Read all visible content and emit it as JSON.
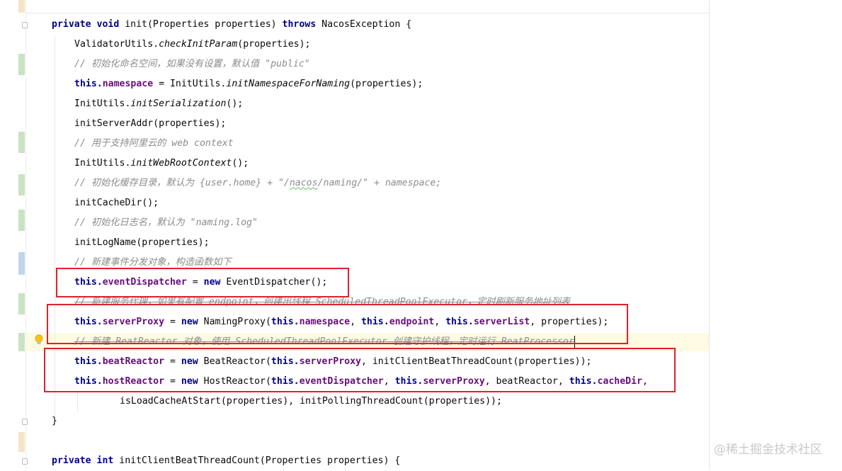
{
  "editor": {
    "lines": {
      "l1": {
        "kw1": "private",
        "kw2": "void",
        "name": " init(Properties properties) ",
        "kw3": "throws",
        "rest": " NacosException {"
      },
      "l2": {
        "a": "ValidatorUtils.",
        "b": "checkInitParam",
        "c": "(properties);"
      },
      "l3": {
        "text": "// 初始化命名空间，如果没有设置，默认值 \"public\""
      },
      "l4": {
        "kw": "this.",
        "fld": "namespace",
        "a": " = InitUtils.",
        "b": "initNamespaceForNaming",
        "c": "(properties);"
      },
      "l5": {
        "a": "InitUtils.",
        "b": "initSerialization",
        "c": "();"
      },
      "l6": {
        "text": "initServerAddr(properties);"
      },
      "l7": {
        "text": "// 用于支持阿里云的 web context"
      },
      "l8": {
        "a": "InitUtils.",
        "b": "initWebRootContext",
        "c": "();"
      },
      "l9": {
        "a": "// 初始化缓存目录，默认为 {user.home} + \"/",
        "b": "nacos",
        "c": "/naming/\" + namespace;"
      },
      "l10": {
        "text": "initCacheDir();"
      },
      "l11": {
        "text": "// 初始化日志名，默认为 \"naming.log\""
      },
      "l12": {
        "text": "initLogName(properties);"
      },
      "l13": {
        "text": "// 新建事件分发对象，构造函数如下"
      },
      "l14": {
        "kw": "this.",
        "fld": "eventDispatcher",
        "a": " = ",
        "kw2": "new",
        "b": " EventDispatcher();"
      },
      "l15": {
        "text": "// 新建服务代理，如果有配置 endpoint，创建出线程 ScheduledThreadPoolExecutor，定时刷新服务地址列表"
      },
      "l16": {
        "kw": "this.",
        "fld": "serverProxy",
        "a": " = ",
        "kw2": "new",
        "b": " NamingProxy(",
        "kw3": "this.",
        "fld2": "namespace",
        "c": ", ",
        "kw4": "this.",
        "fld3": "endpoint",
        "d": ", ",
        "kw5": "this.",
        "fld4": "serverList",
        "e": ", properties);"
      },
      "l17": {
        "text": "// 新建 BeatReactor 对象，使用 ScheduledThreadPoolExecutor 创建守护线程，定时运行 BeatProcessor"
      },
      "l18": {
        "kw": "this.",
        "fld": "beatReactor",
        "a": " = ",
        "kw2": "new",
        "b": " BeatReactor(",
        "kw3": "this.",
        "fld2": "serverProxy",
        "c": ", initClientBeatThreadCount(properties));"
      },
      "l19": {
        "kw": "this.",
        "fld": "hostReactor",
        "a": " = ",
        "kw2": "new",
        "b": " HostReactor(",
        "kw3": "this.",
        "fld2": "eventDispatcher",
        "c": ", ",
        "kw4": "this.",
        "fld3": "serverProxy",
        "d": ", beatReactor, ",
        "kw5": "this.",
        "fld4": "cacheDir",
        "e": ","
      },
      "l20": {
        "text": "isLoadCacheAtStart(properties), initPollingThreadCount(properties));"
      },
      "l21": {
        "text": "}"
      },
      "l22": {
        "kw1": "private",
        "kw2": "int",
        "rest": " initClientBeatThreadCount(Properties properties) {"
      }
    },
    "colors": {
      "keyword": "#00008b",
      "field": "#660e7a",
      "comment": "#8c8c8c",
      "highlight_box": "#e0212b"
    }
  },
  "watermark": {
    "text": "@稀土掘金技术社区"
  },
  "icons": {
    "intention": "lightbulb-icon"
  }
}
